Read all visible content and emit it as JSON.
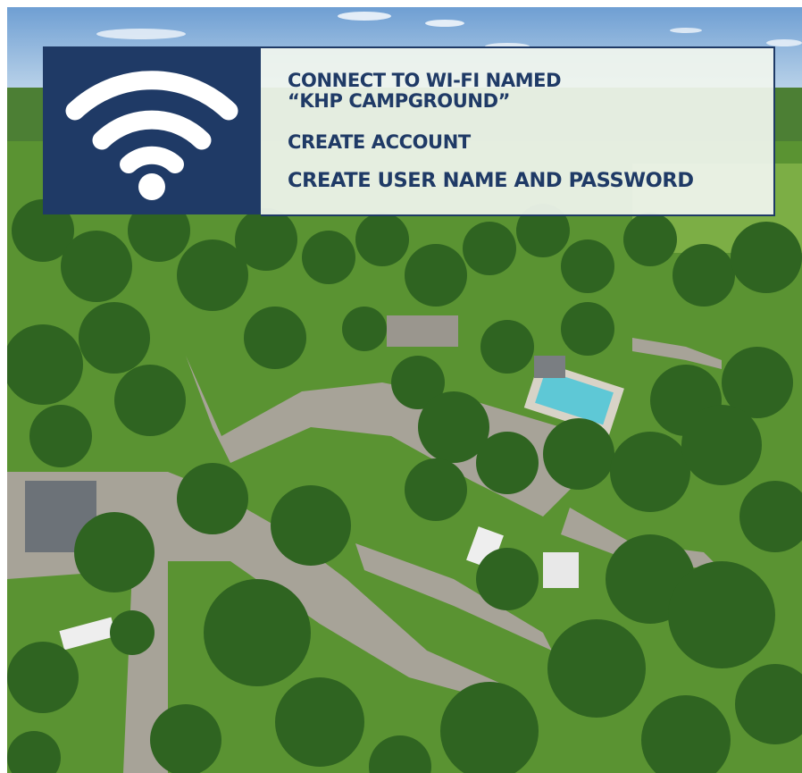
{
  "instructions": {
    "line1": "CONNECT TO WI-FI NAMED",
    "line2": "“KHP CAMPGROUND”",
    "line3": "CREATE ACCOUNT",
    "line4": "CREATE USER NAME AND PASSWORD"
  },
  "icon": "wifi-icon",
  "colors": {
    "navy": "#1f3a66",
    "panel": "#f0f5ee",
    "grass": "#5f9a34",
    "trees": "#2c5a1c",
    "road": "#a9a59c",
    "pool": "#5ec8d6",
    "sky": "#8fb4d8"
  }
}
